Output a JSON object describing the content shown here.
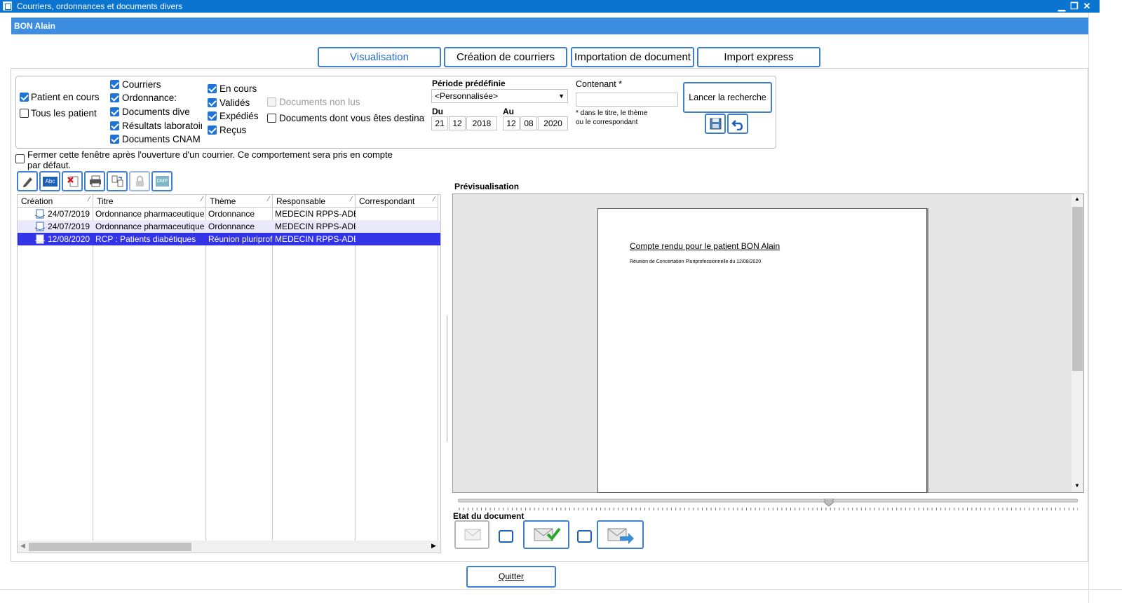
{
  "window": {
    "title": "Courriers, ordonnances et documents divers",
    "controls": [
      "▁",
      "❐",
      "✕"
    ]
  },
  "patient": {
    "name": "BON Alain"
  },
  "tabs": [
    "Visualisation",
    "Création de courriers",
    "Importation de document",
    "Import express"
  ],
  "filters": {
    "patient_scope": [
      {
        "label": "Patient en cours",
        "checked": true
      },
      {
        "label": "Tous les patient",
        "checked": false
      }
    ],
    "types": [
      {
        "label": "Courriers",
        "checked": true
      },
      {
        "label": "Ordonnance:",
        "checked": true
      },
      {
        "label": "Documents dive",
        "checked": true
      },
      {
        "label": "Résultats laboratoir",
        "checked": true
      },
      {
        "label": "Documents CNAM",
        "checked": true
      }
    ],
    "statuses": [
      {
        "label": "En cours",
        "checked": true
      },
      {
        "label": "Validés",
        "checked": true
      },
      {
        "label": "Expédiés",
        "checked": true
      },
      {
        "label": "Reçus",
        "checked": true
      }
    ],
    "unread": {
      "label": "Documents non lus",
      "checked": false,
      "disabled": true
    },
    "recipient": {
      "label": "Documents dont vous êtes destinata",
      "checked": false
    },
    "period": {
      "label": "Période prédéfinie",
      "value": "<Personnalisée>"
    },
    "from": {
      "label": "Du",
      "day": "21",
      "month": "12",
      "year": "2018"
    },
    "to": {
      "label": "Au",
      "day": "12",
      "month": "08",
      "year": "2020"
    },
    "contains": {
      "label": "Contenant *",
      "value": "",
      "hint_line1": "* dans le titre, le thème",
      "hint_line2": "ou le correspondant"
    },
    "search_button": "Lancer la recherche"
  },
  "close_after_open": {
    "label_line1": "Fermer cette fenêtre après l'ouverture d'un courrier. Ce comportement sera pris en compte",
    "label_line2": "par défaut.",
    "checked": false
  },
  "toolbar": [
    "edit-icon",
    "spellcheck-icon",
    "delete-icon",
    "print-icon",
    "transfer-icon",
    "lock-icon",
    "dmp-icon"
  ],
  "toolbar_text": {
    "spell": "Abc",
    "dmp": "DMP"
  },
  "grid": {
    "columns": [
      "Création",
      "Titre",
      "Thème",
      "Responsable",
      "Correspondant"
    ],
    "rows": [
      {
        "date": "24/07/2019",
        "title": "Ordonnance pharmaceutique",
        "theme": "Ordonnance",
        "owner": "MEDECIN RPPS-ADE...",
        "corr": ""
      },
      {
        "date": "24/07/2019",
        "title": "Ordonnance pharmaceutique",
        "theme": "Ordonnance",
        "owner": "MEDECIN RPPS-ADE...",
        "corr": ""
      },
      {
        "date": "12/08/2020",
        "title": "RCP : Patients diabétiques",
        "theme": "Réunion pluriprofe...",
        "owner": "MEDECIN RPPS-ADELI",
        "corr": ""
      }
    ],
    "selected_row": 2
  },
  "preview": {
    "label": "Prévisualisation",
    "doc_title": "Compte rendu pour le patient BON Alain",
    "doc_subtitle": "Réunion de Concertation Pluriprofessionnelle du 12/08/2020"
  },
  "status": {
    "label": "Etat du document",
    "buttons": [
      "envelope-icon",
      "envelope-validated-icon",
      "envelope-sent-icon"
    ]
  },
  "quit_button": "Quitter",
  "colors": {
    "titlebar": "#0b74d1",
    "patientbar": "#3d8ee0",
    "accent": "#3f7fd0",
    "selection": "#3333e8"
  }
}
